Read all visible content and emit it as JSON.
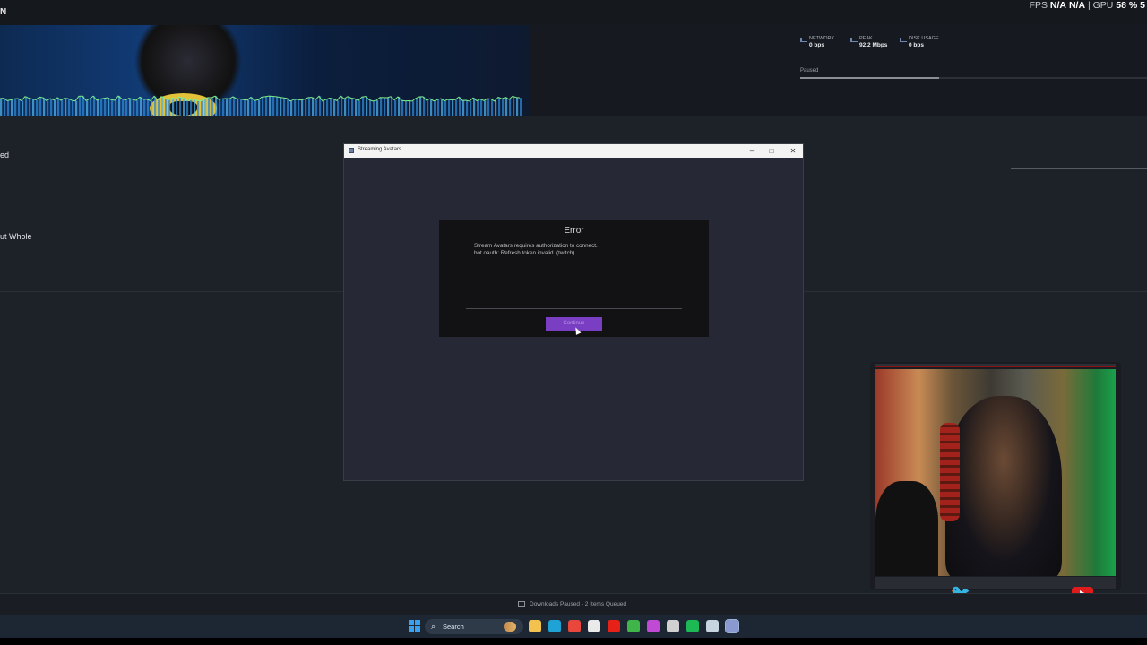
{
  "top_bar": {
    "left_letter": "N",
    "stats_fps_label": "FPS",
    "stats_fps_value": "N/A",
    "stats_fps_value2": "N/A",
    "stats_sep": "|",
    "stats_gpu_label": "GPU",
    "stats_gpu_value": "58 %",
    "stats_gpu_trail": "5"
  },
  "network_panel": {
    "network_label": "NETWORK",
    "network_value": "0 bps",
    "peak_label": "PEAK",
    "peak_value": "92.2 Mbps",
    "disk_label": "DISK USAGE",
    "disk_value": "0 bps",
    "paused_label": "Paused",
    "paused_progress": 0.4
  },
  "background_list": {
    "row1_text": "ed",
    "row2_text": "ut Whole"
  },
  "app_window": {
    "title": "Streaming Avatars",
    "minimize": "–",
    "maximize": "□",
    "close": "✕",
    "error": {
      "title": "Error",
      "message_line1": "Stream Avatars requires authorization to connect.",
      "message_line2": "bot oauth: Refresh token invalid. (twitch)",
      "continue_label": "Continue"
    }
  },
  "downloads_status": {
    "text": "Downloads Paused - 2 Items Queued"
  },
  "taskbar": {
    "search_label": "Search",
    "search_icon": "search-icon",
    "apps": [
      {
        "name": "file-explorer-icon",
        "color": "#f2c14e"
      },
      {
        "name": "edge-icon",
        "color": "#1fa3d6"
      },
      {
        "name": "chrome-icon",
        "color": "#e9473b"
      },
      {
        "name": "store-icon",
        "color": "#eaeaea"
      },
      {
        "name": "youtube-icon",
        "color": "#e62117"
      },
      {
        "name": "xbox-icon",
        "color": "#3fb54a"
      },
      {
        "name": "app-x-icon",
        "color": "#c04ad6"
      },
      {
        "name": "app-dial-icon",
        "color": "#d0d0d0"
      },
      {
        "name": "spotify-icon",
        "color": "#1db954"
      },
      {
        "name": "steam-icon",
        "color": "#c7d5e0"
      },
      {
        "name": "stream-avatars-icon",
        "color": "#8a9ad0"
      }
    ]
  },
  "colors": {
    "accent_purple": "#7a3ec3",
    "twitter_blue": "#5fb7ee",
    "youtube_red": "#e01b1b"
  }
}
